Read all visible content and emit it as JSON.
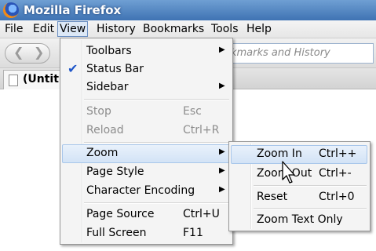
{
  "window": {
    "title": "Mozilla Firefox"
  },
  "menubar": [
    "File",
    "Edit",
    "View",
    "History",
    "Bookmarks",
    "Tools",
    "Help"
  ],
  "navbar": {
    "url_placeholder_visible": "okmarks and History"
  },
  "tab": {
    "label": "(Untit"
  },
  "view_menu": {
    "toolbars": "Toolbars",
    "status_bar": "Status Bar",
    "sidebar": "Sidebar",
    "stop": "Stop",
    "stop_acc": "Esc",
    "reload": "Reload",
    "reload_acc": "Ctrl+R",
    "zoom": "Zoom",
    "page_style": "Page Style",
    "char_encoding": "Character Encoding",
    "page_source": "Page Source",
    "page_source_acc": "Ctrl+U",
    "full_screen": "Full Screen",
    "full_screen_acc": "F11"
  },
  "zoom_menu": {
    "zoom_in": "Zoom In",
    "zoom_in_acc": "Ctrl++",
    "zoom_out": "Zoom Out",
    "zoom_out_acc": "Ctrl+-",
    "reset": "Reset",
    "reset_acc": "Ctrl+0",
    "zoom_text_only": "Zoom Text Only"
  },
  "colors": {
    "check": "#1f56c9",
    "highlight": "#d3e3f6",
    "title_bar": "#4f82bf"
  }
}
